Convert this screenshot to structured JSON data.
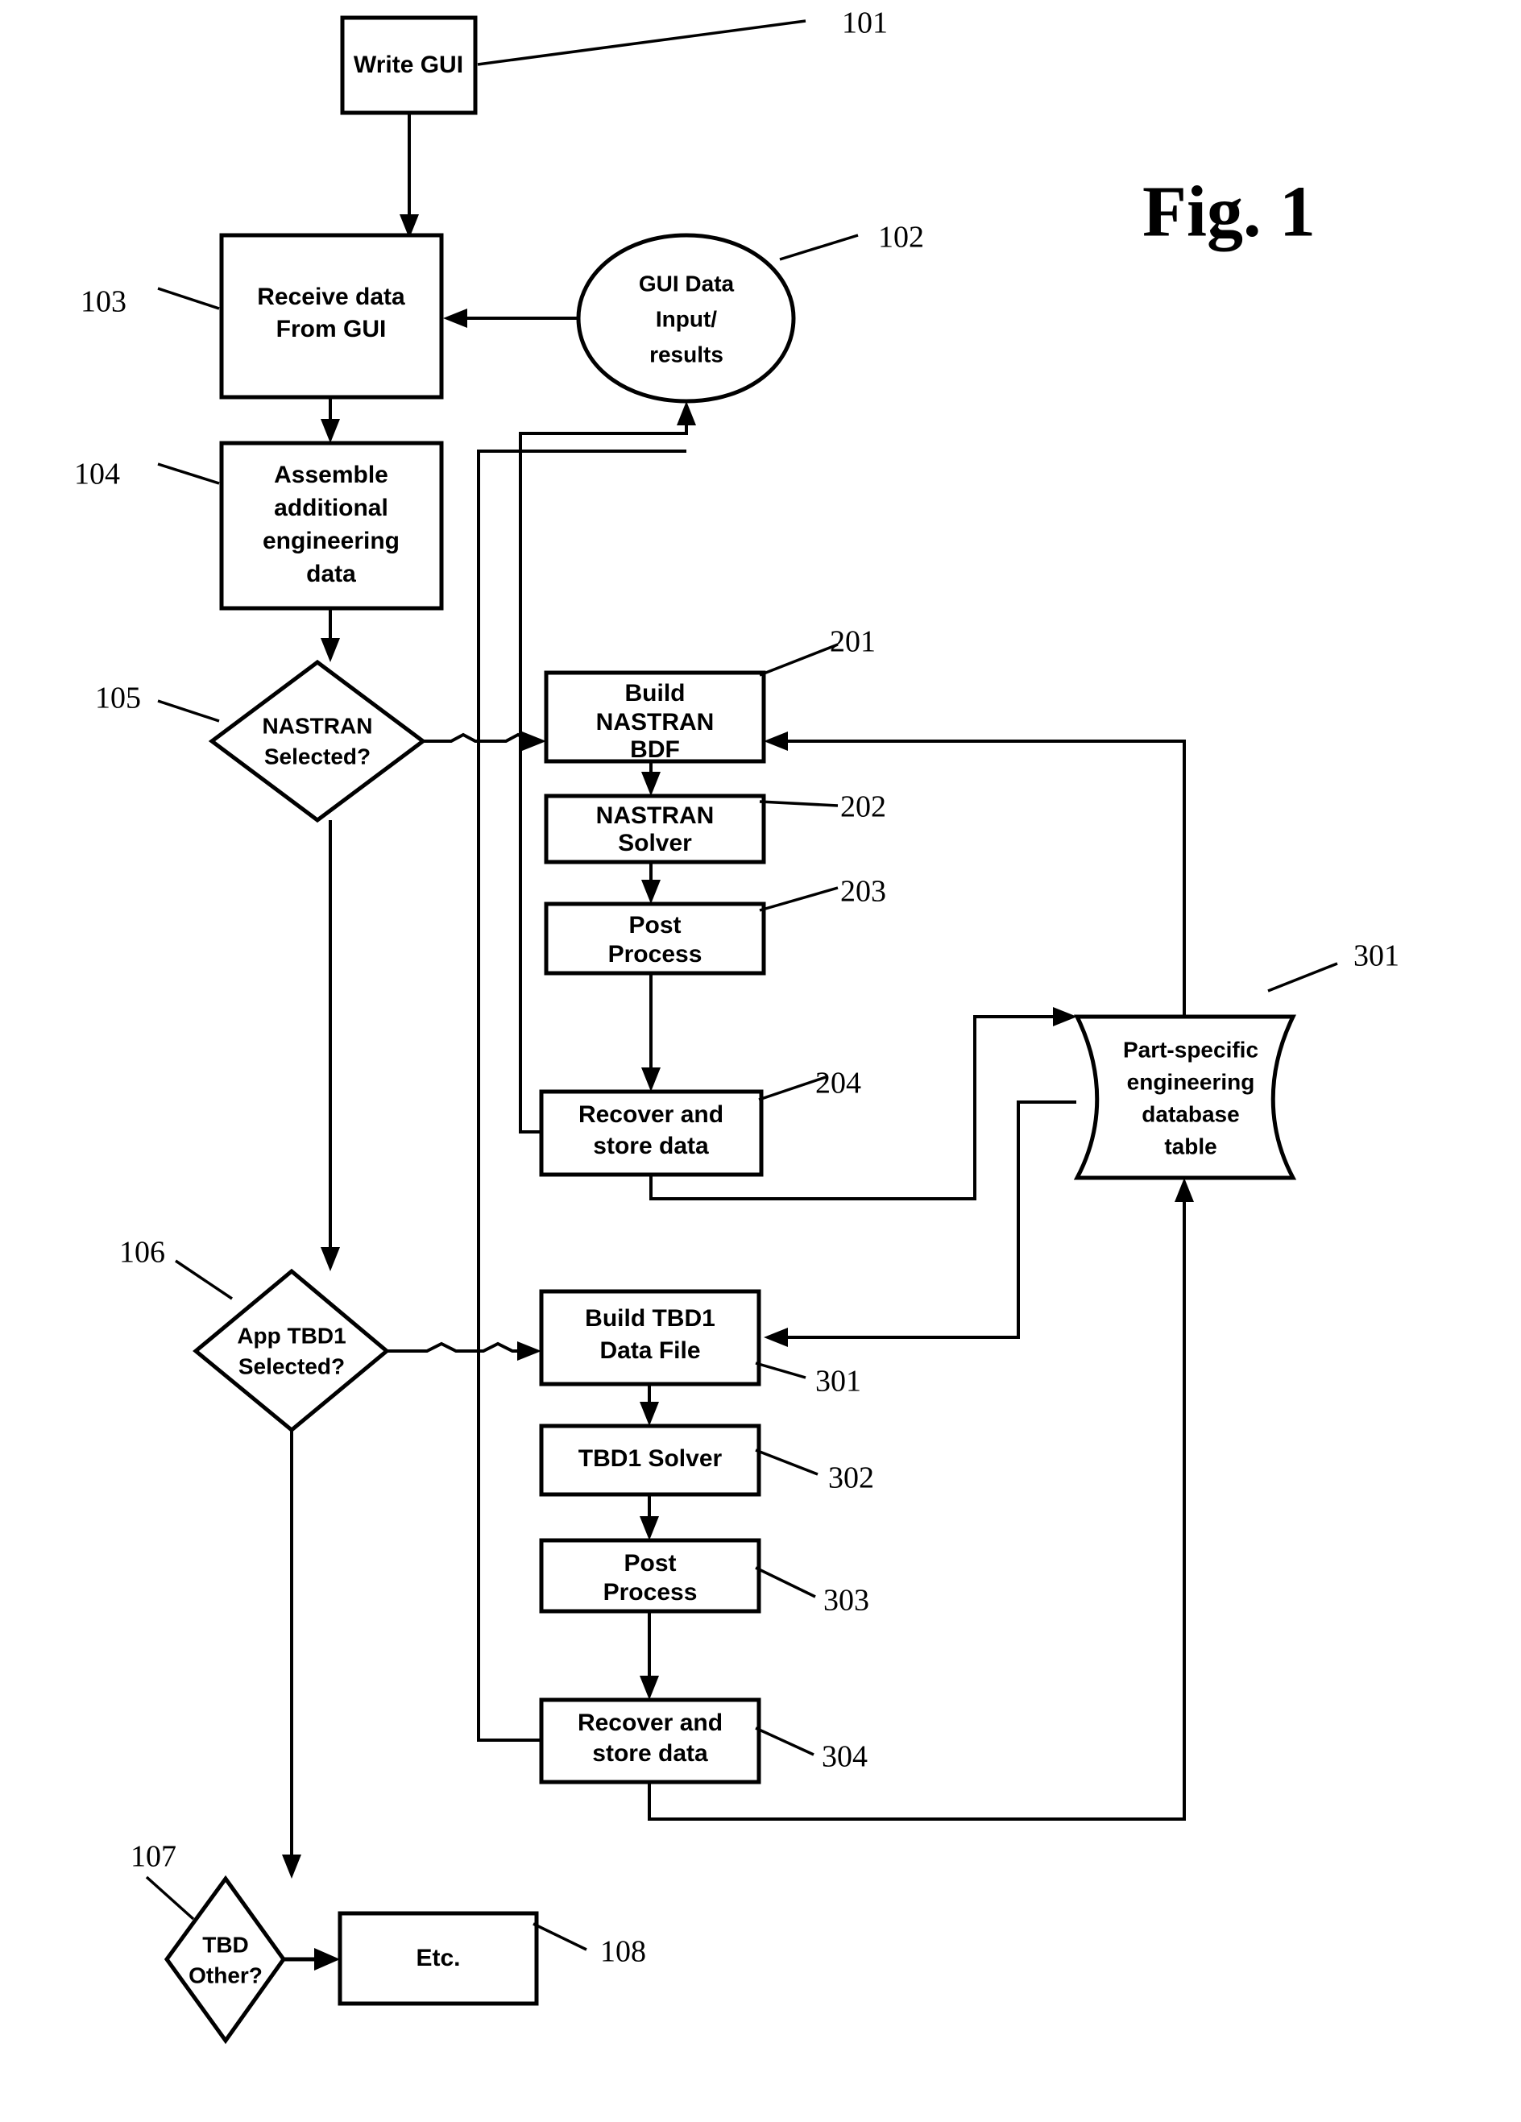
{
  "figure": {
    "title": "Fig. 1",
    "type": "patent-flowchart"
  },
  "nodes": {
    "write_gui": {
      "label": "Write GUI",
      "ref": "101",
      "shape": "process"
    },
    "gui_data": {
      "label_line1": "GUI Data",
      "label_line2": "Input/",
      "label_line3": "results",
      "ref": "102",
      "shape": "oval"
    },
    "receive_data": {
      "label_line1": "Receive data",
      "label_line2": "From GUI",
      "ref": "103",
      "shape": "process"
    },
    "assemble": {
      "label_line1": "Assemble",
      "label_line2": "additional",
      "label_line3": "engineering",
      "label_line4": "data",
      "ref": "104",
      "shape": "process"
    },
    "nastran_decision": {
      "label_line1": "NASTRAN",
      "label_line2": "Selected?",
      "ref": "105",
      "shape": "decision"
    },
    "tbd1_decision": {
      "label_line1": "App TBD1",
      "label_line2": "Selected?",
      "ref": "106",
      "shape": "decision"
    },
    "tbdother_decision": {
      "label_line1": "TBD",
      "label_line2": "Other?",
      "ref": "107",
      "shape": "decision"
    },
    "etc": {
      "label": "Etc.",
      "ref": "108",
      "shape": "process"
    },
    "build_nastran": {
      "label_line1": "Build",
      "label_line2": "NASTRAN",
      "label_line3": "BDF",
      "ref": "201",
      "shape": "process"
    },
    "nastran_solver": {
      "label_line1": "NASTRAN",
      "label_line2": "Solver",
      "ref": "202",
      "shape": "process"
    },
    "post_process_1": {
      "label_line1": "Post",
      "label_line2": "Process",
      "ref": "203",
      "shape": "process"
    },
    "recover_store_1": {
      "label_line1": "Recover and",
      "label_line2": "store data",
      "ref": "204",
      "shape": "process"
    },
    "build_tbd1": {
      "label_line1": "Build TBD1",
      "label_line2": "Data File",
      "ref": "301",
      "shape": "process"
    },
    "tbd1_solver": {
      "label": "TBD1 Solver",
      "ref": "302",
      "shape": "process"
    },
    "post_process_2": {
      "label_line1": "Post",
      "label_line2": "Process",
      "ref": "303",
      "shape": "process"
    },
    "recover_store_2": {
      "label_line1": "Recover and",
      "label_line2": "store data",
      "ref": "304",
      "shape": "process"
    },
    "database": {
      "label_line1": "Part-specific",
      "label_line2": "engineering",
      "label_line3": "database",
      "label_line4": "table",
      "ref": "301",
      "shape": "stored-data"
    }
  },
  "colors": {
    "stroke": "#000000",
    "fill": "#ffffff",
    "background": "#ffffff"
  }
}
